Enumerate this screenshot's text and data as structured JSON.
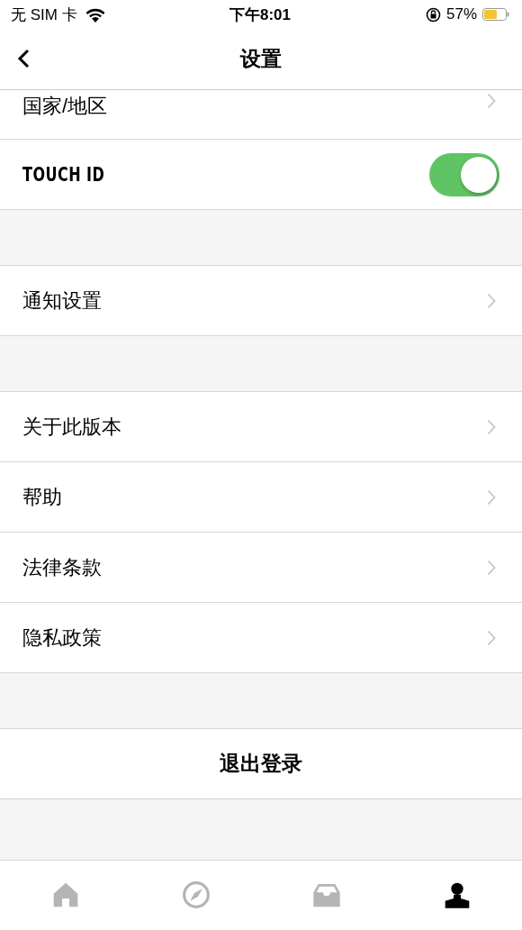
{
  "status_bar": {
    "carrier": "无 SIM 卡",
    "time": "下午8:01",
    "battery": "57%"
  },
  "nav": {
    "title": "设置"
  },
  "groups": [
    {
      "rows": [
        {
          "kind": "link",
          "label": "国家/地区"
        },
        {
          "kind": "toggle",
          "label": "TOUCH ID",
          "on": true
        }
      ]
    },
    {
      "rows": [
        {
          "kind": "link",
          "label": "通知设置"
        }
      ]
    },
    {
      "rows": [
        {
          "kind": "link",
          "label": "关于此版本"
        },
        {
          "kind": "link",
          "label": "帮助"
        },
        {
          "kind": "link",
          "label": "法律条款"
        },
        {
          "kind": "link",
          "label": "隐私政策"
        }
      ]
    },
    {
      "rows": [
        {
          "kind": "action",
          "label": "退出登录"
        }
      ]
    }
  ],
  "tabs": [
    {
      "kind": "home",
      "selected": false
    },
    {
      "kind": "compass",
      "selected": false
    },
    {
      "kind": "inbox",
      "selected": false
    },
    {
      "kind": "person",
      "selected": true
    }
  ]
}
